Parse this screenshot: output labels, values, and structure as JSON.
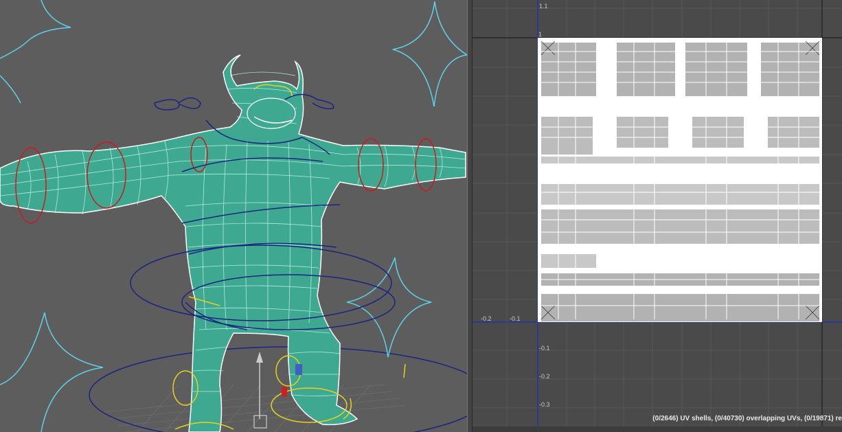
{
  "viewport": {
    "name": "3D perspective viewport",
    "background": "#5d5d5d",
    "mesh_wire_color": "#6fe8c8",
    "mesh_edge_color": "#ffffff",
    "control_colors": {
      "cyan": "#5fd0e8",
      "navy": "#1a2480",
      "red": "#cc1a1a",
      "yellow": "#e8d21a"
    }
  },
  "uv_editor": {
    "background": "#4a4a4a",
    "axis_color": "#2233aa",
    "tile_fill": "#ffffff",
    "ticks": {
      "top_1_1": "1.1",
      "top_1": "1",
      "left_neg_0_2": "-0.2",
      "left_neg_0_1": "-0.1",
      "down_neg_0_1": "-0.1",
      "down_neg_0_2": "-0.2",
      "down_neg_0_3": "-0.3"
    },
    "status": "(0/2646) UV shells, (0/40730) overlapping UVs, (0/19871) re"
  }
}
